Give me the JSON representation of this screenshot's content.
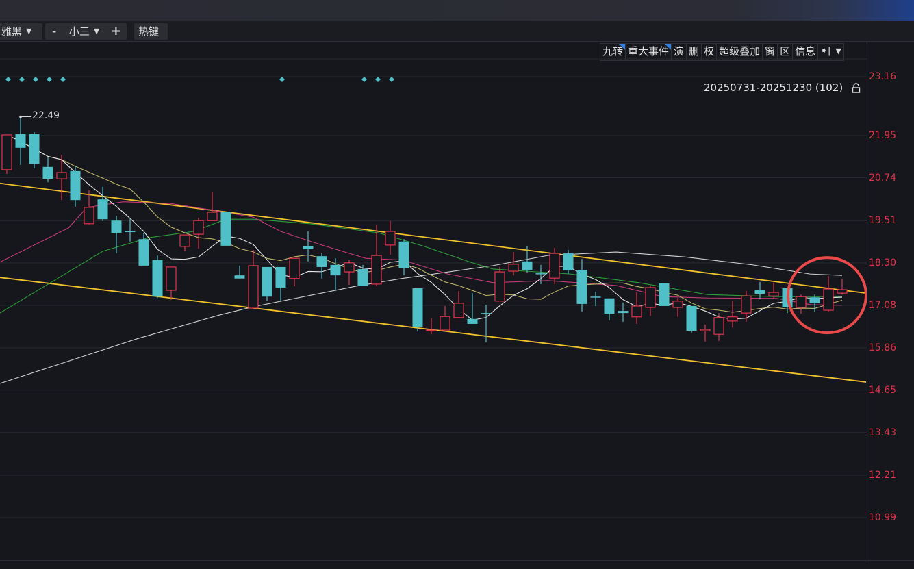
{
  "toolbar": {
    "font_select": "雅黑",
    "size_minus": "-",
    "size_select": "小三",
    "size_plus": "+",
    "hotkey": "热键"
  },
  "chart_tools": [
    "九转",
    "重大事件",
    "演",
    "删",
    "权",
    "超级叠加",
    "窗",
    "区",
    "信息"
  ],
  "chart_tools_flagged": [
    "九转",
    "重大事件"
  ],
  "chart_tools_icons": [
    "collapse-right-icon",
    "chevron-down-icon"
  ],
  "range_label": "20250731-20251230 (102)",
  "colors": {
    "up": "#e0354f",
    "down": "#4fc0c8",
    "axis_label": "#e2334a",
    "channel": "#f2c12e",
    "annotation": "#e84a4a",
    "ma5": "#e6e6e6",
    "ma10": "#bdb46a",
    "ma20": "#c23a78",
    "ma30": "#2e9c3a",
    "ma60": "#cfcfcf"
  },
  "chart_data": {
    "type": "candlestick",
    "y_ticks": [
      "23.16",
      "21.95",
      "20.74",
      "19.51",
      "18.30",
      "17.08",
      "15.86",
      "14.65",
      "13.43",
      "12.21",
      "10.99"
    ],
    "y_tick_values": [
      23.16,
      21.95,
      20.74,
      19.51,
      18.3,
      17.08,
      15.86,
      14.65,
      13.43,
      12.21,
      10.99
    ],
    "ylim": [
      10.5,
      23.5
    ],
    "grid": true,
    "high_marker": {
      "index": 1,
      "label": "22.49"
    },
    "event_markers": [
      0,
      1,
      2,
      3,
      4,
      20,
      26,
      27,
      28
    ],
    "candles": [
      [
        20.97,
        21.97,
        20.85,
        21.97
      ],
      [
        21.99,
        22.49,
        21.11,
        21.6
      ],
      [
        21.99,
        22.05,
        21.01,
        21.13
      ],
      [
        21.05,
        21.32,
        20.61,
        20.71
      ],
      [
        20.71,
        21.4,
        20.1,
        20.89
      ],
      [
        20.93,
        21.07,
        19.91,
        20.1
      ],
      [
        19.42,
        20.4,
        19.4,
        19.89
      ],
      [
        20.12,
        20.48,
        19.5,
        19.55
      ],
      [
        19.51,
        19.65,
        18.57,
        19.16
      ],
      [
        19.22,
        19.57,
        18.91,
        19.18
      ],
      [
        18.98,
        19.16,
        18.22,
        18.22
      ],
      [
        18.38,
        18.51,
        17.29,
        17.33
      ],
      [
        17.51,
        18.18,
        17.24,
        18.18
      ],
      [
        18.77,
        19.1,
        18.63,
        19.1
      ],
      [
        19.12,
        19.59,
        18.71,
        19.51
      ],
      [
        19.51,
        20.34,
        19.51,
        19.75
      ],
      [
        19.75,
        19.75,
        18.79,
        18.79
      ],
      [
        17.94,
        18.22,
        17.85,
        17.85
      ],
      [
        17.0,
        18.67,
        17.0,
        18.22
      ],
      [
        18.18,
        18.18,
        17.2,
        17.33
      ],
      [
        18.18,
        18.18,
        17.2,
        17.59
      ],
      [
        17.85,
        18.43,
        17.63,
        18.43
      ],
      [
        18.77,
        19.2,
        18.34,
        18.69
      ],
      [
        18.49,
        18.57,
        17.85,
        18.18
      ],
      [
        18.24,
        18.43,
        17.49,
        17.94
      ],
      [
        18.04,
        18.38,
        17.67,
        18.3
      ],
      [
        18.12,
        18.24,
        17.63,
        17.63
      ],
      [
        17.69,
        19.4,
        17.63,
        18.51
      ],
      [
        18.81,
        19.5,
        18.53,
        19.2
      ],
      [
        18.91,
        18.98,
        17.94,
        18.14
      ],
      [
        17.57,
        17.57,
        16.33,
        16.47
      ],
      [
        16.35,
        16.71,
        16.25,
        16.37
      ],
      [
        16.37,
        17.06,
        16.37,
        16.76
      ],
      [
        16.73,
        17.49,
        16.73,
        17.14
      ],
      [
        16.69,
        17.43,
        16.55,
        16.55
      ],
      [
        16.86,
        17.1,
        16.02,
        16.84
      ],
      [
        17.2,
        18.18,
        17.2,
        18.04
      ],
      [
        18.06,
        18.61,
        17.94,
        18.26
      ],
      [
        18.34,
        18.77,
        18.02,
        18.1
      ],
      [
        18.0,
        18.24,
        17.69,
        18.0
      ],
      [
        17.86,
        18.73,
        17.69,
        18.57
      ],
      [
        18.57,
        18.67,
        17.98,
        18.08
      ],
      [
        18.1,
        18.41,
        16.9,
        17.12
      ],
      [
        17.33,
        17.47,
        17.06,
        17.33
      ],
      [
        17.28,
        17.28,
        16.65,
        16.84
      ],
      [
        16.92,
        17.16,
        16.61,
        16.86
      ],
      [
        16.75,
        17.45,
        16.55,
        17.06
      ],
      [
        17.02,
        17.65,
        16.78,
        17.59
      ],
      [
        17.71,
        17.71,
        17.06,
        17.06
      ],
      [
        17.02,
        17.29,
        16.75,
        17.2
      ],
      [
        17.06,
        17.06,
        16.29,
        16.35
      ],
      [
        16.35,
        16.53,
        16.04,
        16.39
      ],
      [
        16.25,
        16.86,
        16.06,
        16.73
      ],
      [
        16.63,
        17.2,
        16.45,
        16.75
      ],
      [
        16.86,
        17.49,
        16.61,
        17.35
      ],
      [
        17.51,
        17.75,
        17.26,
        17.41
      ],
      [
        17.35,
        17.73,
        17.26,
        17.45
      ],
      [
        17.57,
        17.57,
        16.86,
        17.02
      ],
      [
        17.02,
        17.39,
        16.84,
        17.33
      ],
      [
        17.31,
        17.39,
        16.9,
        17.14
      ],
      [
        16.94,
        17.92,
        16.88,
        17.55
      ],
      [
        17.43,
        17.83,
        17.39,
        17.53
      ]
    ],
    "ma_lines": {
      "ma20": [
        [
          -0.5,
          18.32
        ],
        [
          4.5,
          19.3
        ],
        [
          5.85,
          19.89
        ],
        [
          8.5,
          20.05
        ],
        [
          12,
          20.0
        ],
        [
          15,
          19.81
        ],
        [
          18,
          19.61
        ],
        [
          20,
          19.2
        ],
        [
          23,
          18.81
        ],
        [
          26.2,
          18.43
        ],
        [
          28.9,
          18.38
        ],
        [
          32.2,
          17.98
        ],
        [
          35.5,
          17.73
        ],
        [
          39.5,
          17.79
        ],
        [
          44.5,
          17.65
        ],
        [
          47.9,
          17.33
        ],
        [
          51.2,
          17.29
        ],
        [
          56.2,
          17.28
        ],
        [
          58.7,
          17.1
        ],
        [
          61,
          17.08
        ]
      ],
      "ma30": [
        [
          -0.5,
          16.86
        ],
        [
          2.85,
          17.65
        ],
        [
          7,
          18.63
        ],
        [
          10.35,
          19.02
        ],
        [
          13.65,
          19.2
        ],
        [
          16,
          19.55
        ],
        [
          18,
          19.55
        ],
        [
          22.15,
          19.42
        ],
        [
          27.15,
          19.16
        ],
        [
          30.5,
          18.77
        ],
        [
          33.85,
          18.32
        ],
        [
          35.5,
          18.12
        ],
        [
          41.15,
          17.98
        ],
        [
          46.15,
          17.73
        ],
        [
          51.15,
          17.39
        ],
        [
          56.15,
          17.33
        ],
        [
          61,
          17.33
        ]
      ],
      "ma60": [
        [
          -0.5,
          14.84
        ],
        [
          9.5,
          16.12
        ],
        [
          15.5,
          16.8
        ],
        [
          18,
          17.04
        ],
        [
          25.5,
          17.63
        ],
        [
          28.85,
          17.85
        ],
        [
          35.5,
          18.22
        ],
        [
          39.5,
          18.51
        ],
        [
          44.5,
          18.61
        ],
        [
          49.5,
          18.47
        ],
        [
          54.5,
          18.24
        ],
        [
          58.65,
          17.98
        ],
        [
          61,
          17.94
        ]
      ]
    },
    "channel": {
      "upper": [
        [
          -0.5,
          20.58
        ],
        [
          62.75,
          17.43
        ]
      ],
      "lower": [
        [
          -0.5,
          17.88
        ],
        [
          62.75,
          14.88
        ]
      ]
    },
    "annotation": {
      "type": "circle",
      "center_index": 59.9,
      "center_price": 17.37
    }
  }
}
